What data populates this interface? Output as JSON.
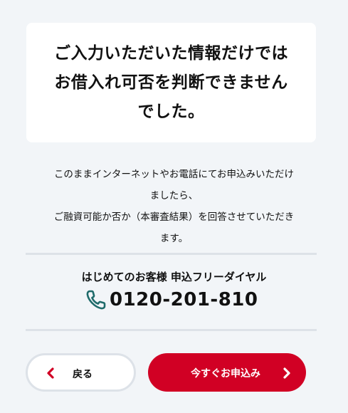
{
  "notice": {
    "title_line1": "ご入力いただいた情報だけでは",
    "title_line2": "お借入れ可否を判断できません",
    "title_line3": "でした。"
  },
  "message": {
    "line1": "このままインターネットやお電話にてお申込みいただけ",
    "line2": "ましたら、",
    "line3": "ご融資可能か否か（本審査結果）を回答させていただき",
    "line4": "ます。"
  },
  "dial": {
    "label": "はじめてのお客様 申込フリーダイヤル",
    "icon": "phone-icon",
    "number": "0120-201-810"
  },
  "buttons": {
    "back_label": "戻る",
    "apply_label": "今すぐお申込み"
  },
  "colors": {
    "accent": "#d10024",
    "background": "#f2f5f8",
    "divider": "#dde2e8",
    "phone_icon": "#1f6b6b"
  }
}
